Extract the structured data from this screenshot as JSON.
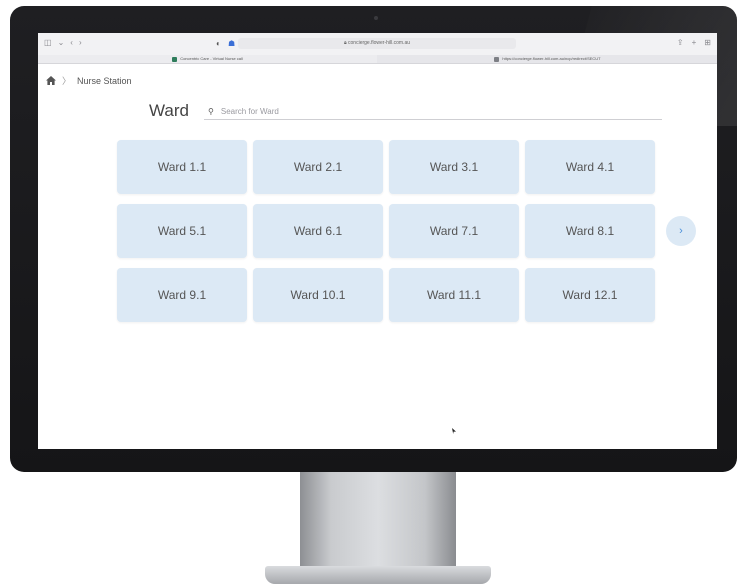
{
  "browser": {
    "url": "concierge.flower-hill.com.au",
    "tabs": [
      {
        "title": "Concentric Care - Virtual Nurse call",
        "favicon_color": "#2f7d5c"
      },
      {
        "title": "https://concierge.flower-hill.com.au/ncp/redirect/SECUT",
        "favicon_color": "#7d7f85"
      }
    ],
    "toolbar_icons": [
      "sidebar-icon",
      "chevron-down-icon",
      "back-icon",
      "forward-icon",
      "shield-icon",
      "extension-icon",
      "share-icon",
      "new-tab-icon",
      "tab-overview-icon"
    ]
  },
  "breadcrumb": {
    "home_icon": "home-icon",
    "separator": "〉",
    "current": "Nurse Station"
  },
  "header": {
    "title": "Ward",
    "search_placeholder": "Search for Ward",
    "search_value": ""
  },
  "wards": [
    "Ward 1.1",
    "Ward 2.1",
    "Ward 3.1",
    "Ward 4.1",
    "Ward 5.1",
    "Ward 6.1",
    "Ward 7.1",
    "Ward 8.1",
    "Ward 9.1",
    "Ward 10.1",
    "Ward 11.1",
    "Ward 12.1"
  ],
  "pagination": {
    "next_icon": "chevron-right-icon",
    "next_glyph": "›"
  },
  "colors": {
    "card_bg": "#dce9f5",
    "accent": "#4a90d9",
    "bezel": "#1f1f22"
  }
}
